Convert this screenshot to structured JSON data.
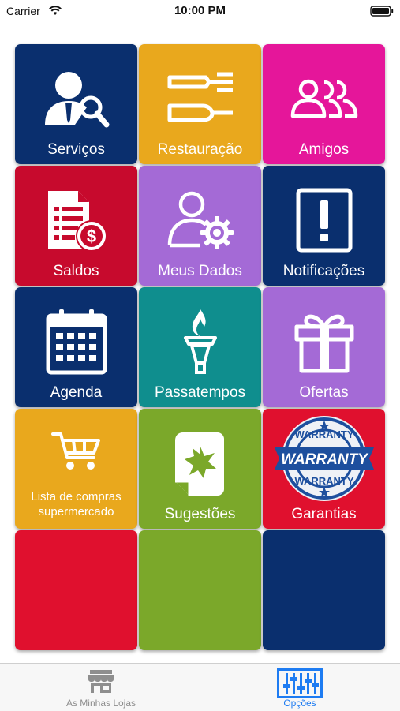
{
  "status_bar": {
    "carrier": "Carrier",
    "time": "10:00 PM"
  },
  "tiles": [
    {
      "label": "Serviços",
      "color": "#0a2f6e",
      "icon": "person-search-icon"
    },
    {
      "label": "Restauração",
      "color": "#e9a81d",
      "icon": "cutlery-icon"
    },
    {
      "label": "Amigos",
      "color": "#e5169a",
      "icon": "people-group-icon"
    },
    {
      "label": "Saldos",
      "color": "#c70a2d",
      "icon": "document-dollar-icon"
    },
    {
      "label": "Meus Dados",
      "color": "#a46ad6",
      "icon": "user-gear-icon"
    },
    {
      "label": "Notificações",
      "color": "#0a2f6e",
      "icon": "exclamation-icon"
    },
    {
      "label": "Agenda",
      "color": "#0a2f6e",
      "icon": "calendar-icon"
    },
    {
      "label": "Passatempos",
      "color": "#0f8e8e",
      "icon": "torch-icon"
    },
    {
      "label": "Ofertas",
      "color": "#a46ad6",
      "icon": "gift-icon"
    },
    {
      "label": "Lista de compras supermercado",
      "color": "#e9a81d",
      "icon": "shopping-cart-icon"
    },
    {
      "label": "Sugestões",
      "color": "#7ba82a",
      "icon": "suggestion-document-icon"
    },
    {
      "label": "Garantias",
      "color": "#e0102e",
      "icon": "warranty-seal-icon",
      "seal_text": "WARRANTY"
    },
    {
      "label": "",
      "color": "#e0102e"
    },
    {
      "label": "",
      "color": "#7ba82a"
    },
    {
      "label": "",
      "color": "#0a2f6e"
    }
  ],
  "tab_bar": {
    "tabs": [
      {
        "label": "As Minhas Lojas",
        "icon": "store-icon",
        "selected": false,
        "color": "#8e8e8e"
      },
      {
        "label": "Opções",
        "icon": "sliders-icon",
        "selected": true,
        "color": "#1e7cf2"
      }
    ]
  }
}
